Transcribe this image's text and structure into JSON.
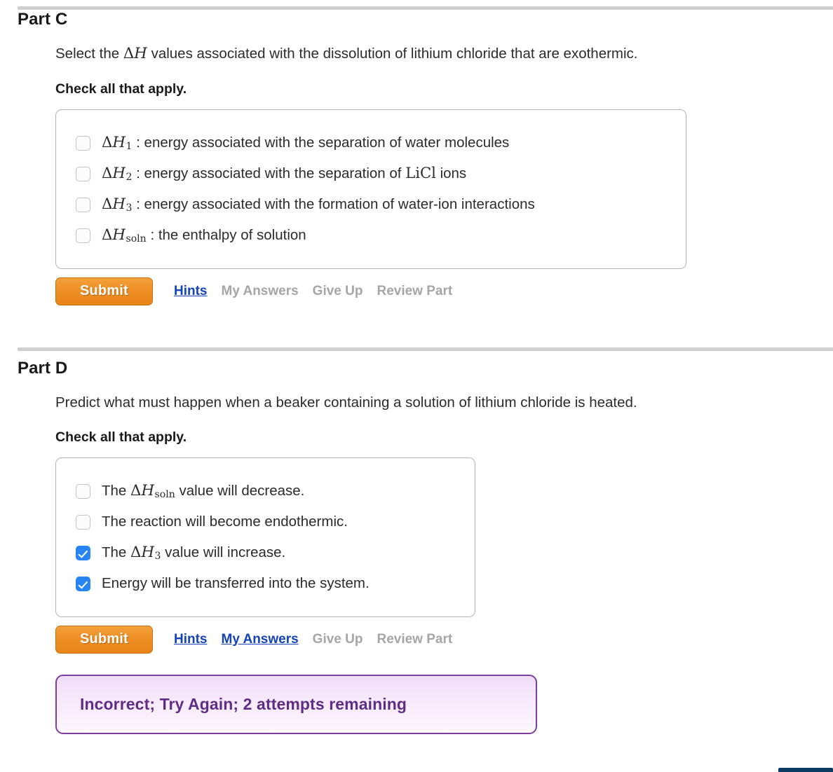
{
  "parts": [
    {
      "title": "Part C",
      "question_prefix": "Select the ",
      "question_math": "ΔH",
      "question_suffix": " values associated with the dissolution of lithium chloride that are exothermic.",
      "check_all_label": "Check all that apply.",
      "options": [
        {
          "checked": false,
          "math": "ΔH",
          "sub": "1",
          "text": " : energy associated with the separation of water molecules"
        },
        {
          "checked": false,
          "math": "ΔH",
          "sub": "2",
          "text_before_formula": " : energy associated with the separation of ",
          "formula": "LiCl",
          "text_after_formula": " ions"
        },
        {
          "checked": false,
          "math": "ΔH",
          "sub": "3",
          "text": " : energy associated with the formation of water-ion interactions"
        },
        {
          "checked": false,
          "math": "ΔH",
          "sub": "soln",
          "text": " : the enthalpy of solution"
        }
      ],
      "submit_label": "Submit",
      "links": [
        {
          "label": "Hints",
          "state": "active"
        },
        {
          "label": "My Answers",
          "state": "disabled"
        },
        {
          "label": "Give Up",
          "state": "disabled"
        },
        {
          "label": "Review Part",
          "state": "disabled"
        }
      ],
      "feedback": null
    },
    {
      "title": "Part D",
      "question_prefix": "Predict what must happen when a beaker containing a solution of lithium chloride is heated.",
      "check_all_label": "Check all that apply.",
      "options": [
        {
          "checked": false,
          "text_before": "The ",
          "math": "ΔH",
          "sub": "soln",
          "text_after": "  value will decrease."
        },
        {
          "checked": false,
          "text_before": "The reaction will become endothermic.",
          "math": "",
          "sub": "",
          "text_after": ""
        },
        {
          "checked": true,
          "text_before": "The ",
          "math": "ΔH",
          "sub": "3",
          "text_after": "  value will increase."
        },
        {
          "checked": true,
          "text_before": "Energy will be transferred into the system.",
          "math": "",
          "sub": "",
          "text_after": ""
        }
      ],
      "submit_label": "Submit",
      "links": [
        {
          "label": "Hints",
          "state": "active"
        },
        {
          "label": "My Answers",
          "state": "active"
        },
        {
          "label": "Give Up",
          "state": "disabled"
        },
        {
          "label": "Review Part",
          "state": "disabled"
        }
      ],
      "feedback": {
        "text": "Incorrect; Try Again; 2 attempts remaining"
      }
    }
  ],
  "colors": {
    "submit_orange": "#ee8f23",
    "link_blue": "#1442b8",
    "link_disabled_gray": "#a6a6a6",
    "checkbox_checked_blue": "#2684f5",
    "feedback_border_purple": "#7b3f9d",
    "feedback_text_purple": "#5f2d86",
    "rule_gray": "#cfcfcf",
    "bottom_bar_navy": "#0b3b60"
  }
}
